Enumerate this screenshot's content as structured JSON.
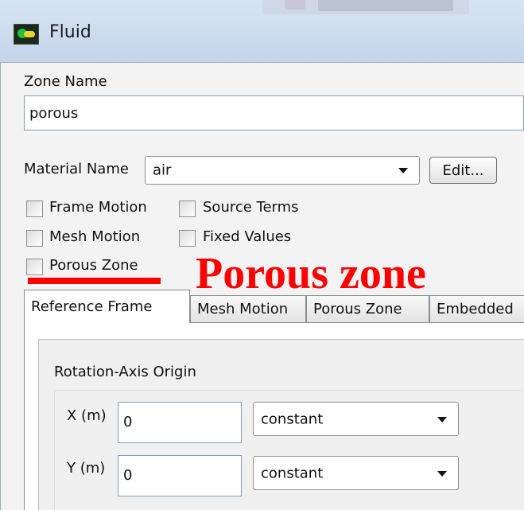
{
  "window": {
    "title": "Fluid"
  },
  "zone": {
    "label": "Zone Name",
    "value": "porous"
  },
  "material": {
    "label": "Material Name",
    "value": "air",
    "edit_label": "Edit..."
  },
  "checkboxes": {
    "frame_motion": "Frame Motion",
    "source_terms": "Source Terms",
    "mesh_motion": "Mesh Motion",
    "fixed_values": "Fixed Values",
    "porous_zone": "Porous Zone"
  },
  "annotation": {
    "text": "Porous zone",
    "color": "#ff0000"
  },
  "tabs": [
    "Reference Frame",
    "Mesh Motion",
    "Porous Zone",
    "Embedded"
  ],
  "active_tab": "Reference Frame",
  "rotation_origin": {
    "title": "Rotation-Axis Origin",
    "rows": [
      {
        "label": "X (m)",
        "value": "0",
        "method": "constant"
      },
      {
        "label": "Y (m)",
        "value": "0",
        "method": "constant"
      }
    ]
  }
}
